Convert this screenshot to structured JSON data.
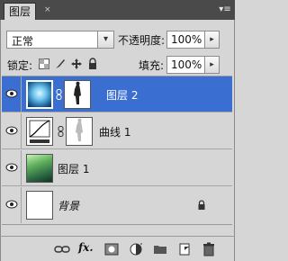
{
  "panel": {
    "tab_label": "图层",
    "close_glyph": "×",
    "menu_glyph": "▾≡"
  },
  "blend": {
    "value": "正常",
    "arrow": "▾"
  },
  "opacity": {
    "label": "不透明度:",
    "value": "100%",
    "arrow": "▸"
  },
  "lock": {
    "label": "锁定:"
  },
  "fill": {
    "label": "填充:",
    "value": "100%",
    "arrow": "▸"
  },
  "layers": [
    {
      "name": "图层 2",
      "selected": true,
      "has_mask": true
    },
    {
      "name": "曲线 1",
      "selected": false,
      "has_mask": true
    },
    {
      "name": "图层 1",
      "selected": false,
      "has_mask": false
    },
    {
      "name": "背景",
      "selected": false,
      "has_mask": false,
      "locked": true
    }
  ],
  "footer": {
    "fx_label": "fx."
  },
  "colors": {
    "selection": "#3a6fd1",
    "panel_bg": "#d6d6d6",
    "title_bg": "#4a4a4a"
  }
}
